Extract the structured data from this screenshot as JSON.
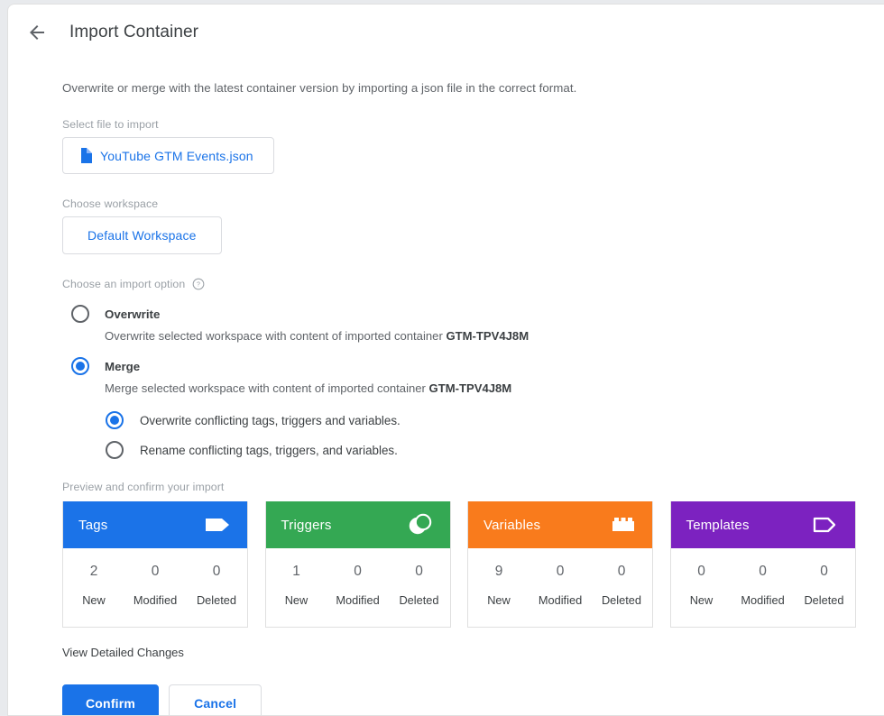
{
  "header": {
    "back_icon": "arrow-left-icon",
    "title": "Import Container"
  },
  "intro": "Overwrite or merge with the latest container version by importing a json file in the correct format.",
  "file_section": {
    "label": "Select file to import",
    "file_icon": "document-icon",
    "file_name": "YouTube GTM Events.json"
  },
  "workspace_section": {
    "label": "Choose workspace",
    "workspace_name": "Default Workspace"
  },
  "import_option": {
    "label": "Choose an import option",
    "help_icon": "help-circle-icon",
    "options": [
      {
        "title": "Overwrite",
        "desc_prefix": "Overwrite selected workspace with content of imported container ",
        "container_id": "GTM-TPV4J8M",
        "selected": false
      },
      {
        "title": "Merge",
        "desc_prefix": "Merge selected workspace with content of imported container ",
        "container_id": "GTM-TPV4J8M",
        "selected": true
      }
    ],
    "merge_sub_options": [
      {
        "label": "Overwrite conflicting tags, triggers and variables.",
        "selected": true
      },
      {
        "label": "Rename conflicting tags, triggers, and variables.",
        "selected": false
      }
    ]
  },
  "preview": {
    "label": "Preview and confirm your import",
    "stat_labels": [
      "New",
      "Modified",
      "Deleted"
    ],
    "cards": [
      {
        "title": "Tags",
        "icon": "tag-filled-icon",
        "color": "#1b73e8",
        "new": "2",
        "modified": "0",
        "deleted": "0"
      },
      {
        "title": "Triggers",
        "icon": "trigger-circles-icon",
        "color": "#34a853",
        "new": "1",
        "modified": "0",
        "deleted": "0"
      },
      {
        "title": "Variables",
        "icon": "brick-icon",
        "color": "#f97b1c",
        "new": "9",
        "modified": "0",
        "deleted": "0"
      },
      {
        "title": "Templates",
        "icon": "tag-outline-icon",
        "color": "#7c22c0",
        "new": "0",
        "modified": "0",
        "deleted": "0"
      }
    ]
  },
  "footer": {
    "detail_link": "View Detailed Changes",
    "confirm_label": "Confirm",
    "cancel_label": "Cancel"
  }
}
